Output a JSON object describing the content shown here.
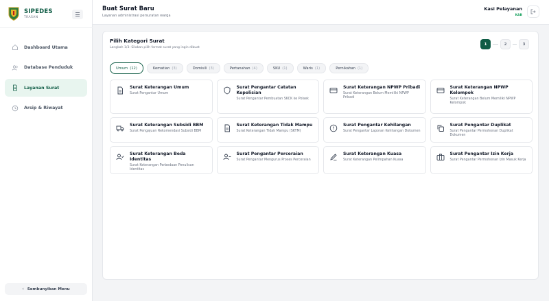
{
  "app": {
    "name": "SIPEDES",
    "sub": "TRASAN"
  },
  "sidebar": {
    "items": [
      {
        "label": "Dashboard Utama",
        "icon": "home-icon"
      },
      {
        "label": "Database Penduduk",
        "icon": "users-icon"
      },
      {
        "label": "Layanan Surat",
        "icon": "document-icon",
        "active": true
      },
      {
        "label": "Arsip & Riwayat",
        "icon": "clock-icon"
      }
    ],
    "hide_label": "Sembunyikan Menu"
  },
  "header": {
    "title": "Buat Surat Baru",
    "subtitle": "Layanan administrasi persuratan warga",
    "user_name": "Kasi Pelayanan",
    "user_role": "KAB"
  },
  "card": {
    "title": "Pilih Kategori Surat",
    "subtitle": "Langkah 1/3: Silakan pilih format surat yang ingin dibuat"
  },
  "steps": [
    "1",
    "2",
    "3"
  ],
  "filters": [
    {
      "label": "Umum",
      "count": "(12)",
      "active": true
    },
    {
      "label": "Kematian",
      "count": "(3)"
    },
    {
      "label": "Domisili",
      "count": "(3)"
    },
    {
      "label": "Pertanahan",
      "count": "(4)"
    },
    {
      "label": "SKU",
      "count": "(1)"
    },
    {
      "label": "Waris",
      "count": "(1)"
    },
    {
      "label": "Pernikahan",
      "count": "(1)"
    }
  ],
  "templates": [
    {
      "title": "Surat Keterangan Umum",
      "desc": "Surat Pengantar Umum",
      "icon": "document-icon"
    },
    {
      "title": "Surat Pengantar Catatan Kepolisian",
      "desc": "Surat Pengantar Pembuatan SKCK ke Polsek",
      "icon": "shield-icon"
    },
    {
      "title": "Surat Keterangan NPWP Pribadi",
      "desc": "Surat Keterangan Belum Memiliki NPWP Pribadi",
      "icon": "card-icon"
    },
    {
      "title": "Surat Keterangan NPWP Kelompok",
      "desc": "Surat Keterangan Belum Memiliki NPWP Kelompok",
      "icon": "card-icon"
    },
    {
      "title": "Surat Keterangan Subsidi BBM",
      "desc": "Surat Pengajuan Rekomendasi Subsidi BBM",
      "icon": "truck-icon"
    },
    {
      "title": "Surat Keterangan Tidak Mampu",
      "desc": "Surat Keterangan Tidak Mampu (SKTM)",
      "icon": "document-icon"
    },
    {
      "title": "Surat Pengantar Kehilangan",
      "desc": "Surat Pengantar Laporan Kehilangan Dokumen",
      "icon": "alert-circle-icon"
    },
    {
      "title": "Surat Pengantar Duplikat",
      "desc": "Surat Pengantar Permohonan Duplikat Dokumen",
      "icon": "copy-icon"
    },
    {
      "title": "Surat Keterangan Beda Identitas",
      "desc": "Surat Keterangan Perbedaan Penulisan Identitas",
      "icon": "user-check-icon"
    },
    {
      "title": "Surat Pengantar Perceraian",
      "desc": "Surat Pengantar Mengurus Proses Perceraian",
      "icon": "user-minus-icon"
    },
    {
      "title": "Surat Keterangan Kuasa",
      "desc": "Surat Keterangan Pelimpahan Kuasa",
      "icon": "pen-icon"
    },
    {
      "title": "Surat Pengantar Izin Kerja",
      "desc": "Surat Pengantar Permohonan Izin Masuk Kerja",
      "icon": "briefcase-icon"
    }
  ],
  "colors": {
    "brand": "#0f5c45",
    "accent_light": "#e8f5ef",
    "role": "#0f9d58"
  }
}
